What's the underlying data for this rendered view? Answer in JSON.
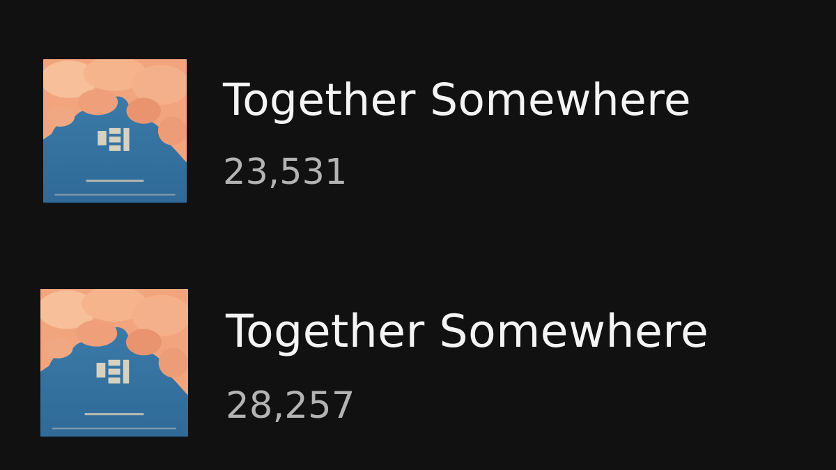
{
  "tracks": [
    {
      "title": "Together Somewhere",
      "plays": "23,531",
      "cover_icon": "album-cover-clouds-sky"
    },
    {
      "title": "Together Somewhere",
      "plays": "28,257",
      "cover_icon": "album-cover-clouds-sky"
    }
  ],
  "colors": {
    "background": "#111112",
    "title_text": "#f4f4f4",
    "plays_text": "#b3b3b3",
    "sky_blue": "#3f79a6",
    "cloud_peach": "#f0a47c"
  }
}
